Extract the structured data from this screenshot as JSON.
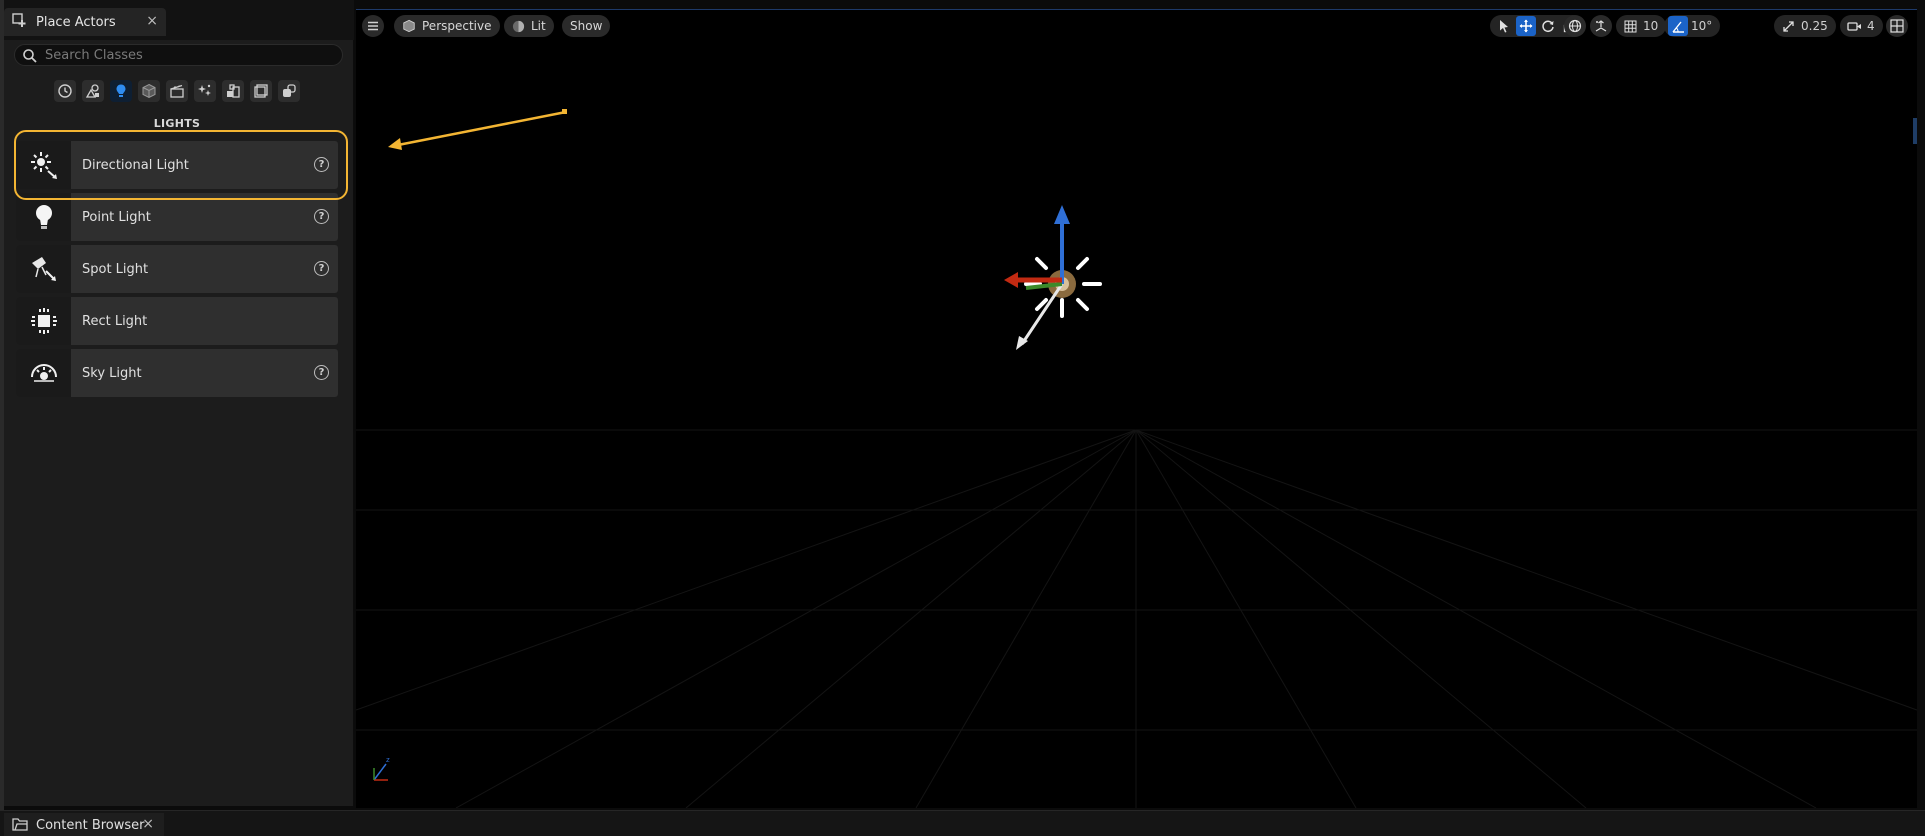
{
  "place_actors_tab": {
    "title": "Place Actors",
    "close": "×"
  },
  "search": {
    "placeholder": "Search Classes",
    "value": ""
  },
  "categories": [
    {
      "icon": "clock-icon",
      "active": false
    },
    {
      "icon": "basic-shapes-icon",
      "active": false
    },
    {
      "icon": "lightbulb-icon",
      "active": true
    },
    {
      "icon": "cube-icon",
      "active": false
    },
    {
      "icon": "cinematic-icon",
      "active": false
    },
    {
      "icon": "visual-effects-icon",
      "active": false
    },
    {
      "icon": "geometry-icon",
      "active": false
    },
    {
      "icon": "volumes-icon",
      "active": false
    },
    {
      "icon": "all-classes-icon",
      "active": false
    }
  ],
  "section_label": "LIGHTS",
  "items": [
    {
      "label": "Directional Light",
      "icon": "directional-light-icon",
      "help": "?"
    },
    {
      "label": "Point Light",
      "icon": "point-light-icon",
      "help": "?"
    },
    {
      "label": "Spot Light",
      "icon": "spot-light-icon",
      "help": "?"
    },
    {
      "label": "Rect Light",
      "icon": "rect-light-icon"
    },
    {
      "label": "Sky Light",
      "icon": "sky-light-icon",
      "help": "?"
    }
  ],
  "viewport": {
    "perspective_label": "Perspective",
    "lit_label": "Lit",
    "show_label": "Show",
    "grid_snap": "10",
    "rotation_snap": "10°",
    "scale_snap": "0.25",
    "camera_speed": "4"
  },
  "content_browser_tab": {
    "title": "Content Browser",
    "close": "×"
  },
  "colors": {
    "highlight": "#f3b533",
    "accent_blue": "#1b63c7",
    "panel_bg": "#1c1c1c"
  }
}
